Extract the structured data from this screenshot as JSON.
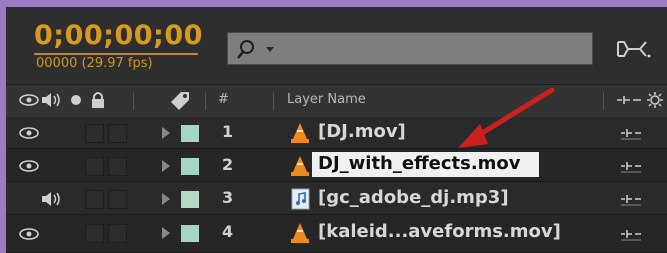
{
  "timecode": {
    "value": "0;00;00;00",
    "frames": "00000 (29.97 fps)"
  },
  "search": {
    "placeholder": ""
  },
  "columns": {
    "number": "#",
    "layer_name": "Layer Name"
  },
  "layers": [
    {
      "number": "1",
      "name": "[DJ.mov]",
      "type": "video",
      "editing": false,
      "eye": true,
      "audio": false
    },
    {
      "number": "2",
      "name": "DJ_with_effects.mov",
      "type": "video",
      "editing": true,
      "eye": true,
      "audio": false
    },
    {
      "number": "3",
      "name": "[gc_adobe_dj.mp3]",
      "type": "audio",
      "editing": false,
      "eye": false,
      "audio": true
    },
    {
      "number": "4",
      "name": "[kaleid...aveforms.mov]",
      "type": "video",
      "editing": false,
      "eye": true,
      "audio": false
    }
  ],
  "colors": {
    "timecode": "#d79a1e",
    "label_swatch": "#a5d6c3",
    "annotation_arrow": "#cc1f1f",
    "window_frame": "#9a7cc6"
  }
}
